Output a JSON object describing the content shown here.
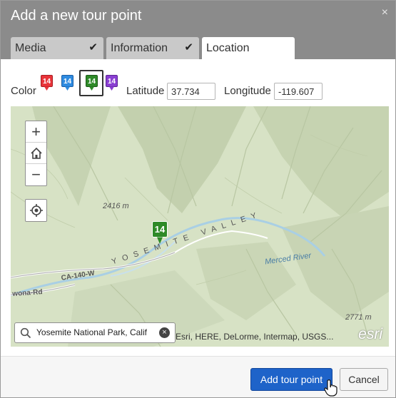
{
  "dialog": {
    "title": "Add a new tour point",
    "close_glyph": "×"
  },
  "tabs": [
    {
      "label": "Media",
      "completed": true,
      "active": false
    },
    {
      "label": "Information",
      "completed": true,
      "active": false
    },
    {
      "label": "Location",
      "completed": false,
      "active": true
    }
  ],
  "check_glyph": "✔",
  "color": {
    "label": "Color",
    "options": [
      {
        "name": "red",
        "hex": "#e8343a",
        "number": "14"
      },
      {
        "name": "blue",
        "hex": "#2f8be0",
        "number": "14"
      },
      {
        "name": "green",
        "hex": "#2e8a28",
        "number": "14",
        "selected": true
      },
      {
        "name": "purple",
        "hex": "#8a3fd2",
        "number": "14"
      }
    ]
  },
  "latitude": {
    "label": "Latitude",
    "value": "37.734"
  },
  "longitude": {
    "label": "Longitude",
    "value": "-119.607"
  },
  "map": {
    "zoom_in": "+",
    "zoom_out": "−",
    "elevation_1": "2416 m",
    "elevation_2": "2771 m",
    "valley_label": "YOSEMITE VALLEY",
    "river_label": "Merced River",
    "road_1": "CA-140-W",
    "road_2": "wona-Rd",
    "marker_number": "14",
    "search_value": "Yosemite National Park, Calif",
    "clear_glyph": "×",
    "attribution": "Esri, HERE, DeLorme, Intermap, USGS...",
    "esri_logo": "esri"
  },
  "buttons": {
    "add": "Add tour point",
    "cancel": "Cancel"
  },
  "colors": {
    "header_bg": "#8b8b8b",
    "primary": "#1e63c9",
    "terrain": "#d7e2c5"
  }
}
